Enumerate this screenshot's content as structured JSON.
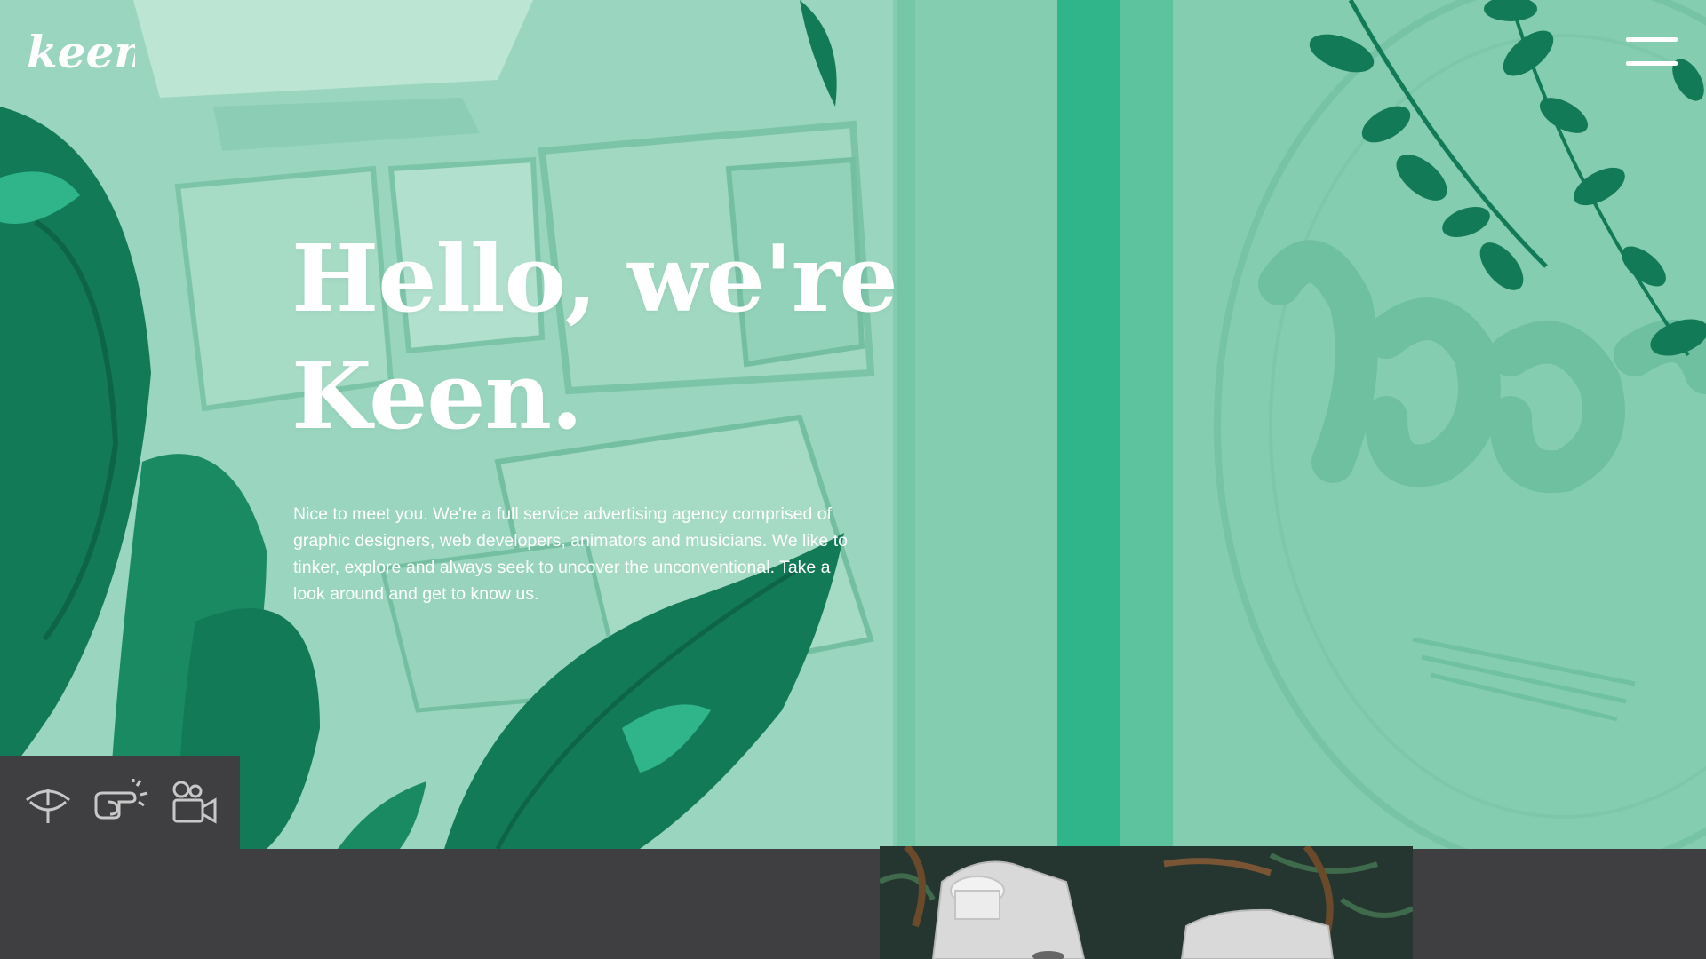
{
  "brand": {
    "logo_text": "keen",
    "color": "#ffffff"
  },
  "nav": {
    "menu_icon": "hamburger-menu-icon"
  },
  "hero": {
    "headline_line1": "Hello, we're",
    "headline_line2": "Keen.",
    "intro": "Nice to meet you. We're a full service advertising agency comprised of graphic designers, web developers, animators and musicians. We like to tinker, explore and always seek to uncover the unconventional. Take a look around and get to know us.",
    "colors": {
      "tint": "#8fd0b7",
      "accent": "#2fb589",
      "dark_green": "#137a58"
    }
  },
  "social": {
    "items": [
      {
        "icon": "eye-icon"
      },
      {
        "icon": "pointing-hand-icon"
      },
      {
        "icon": "video-camera-person-icon"
      }
    ]
  },
  "colors": {
    "background_dark": "#3f3f41"
  }
}
